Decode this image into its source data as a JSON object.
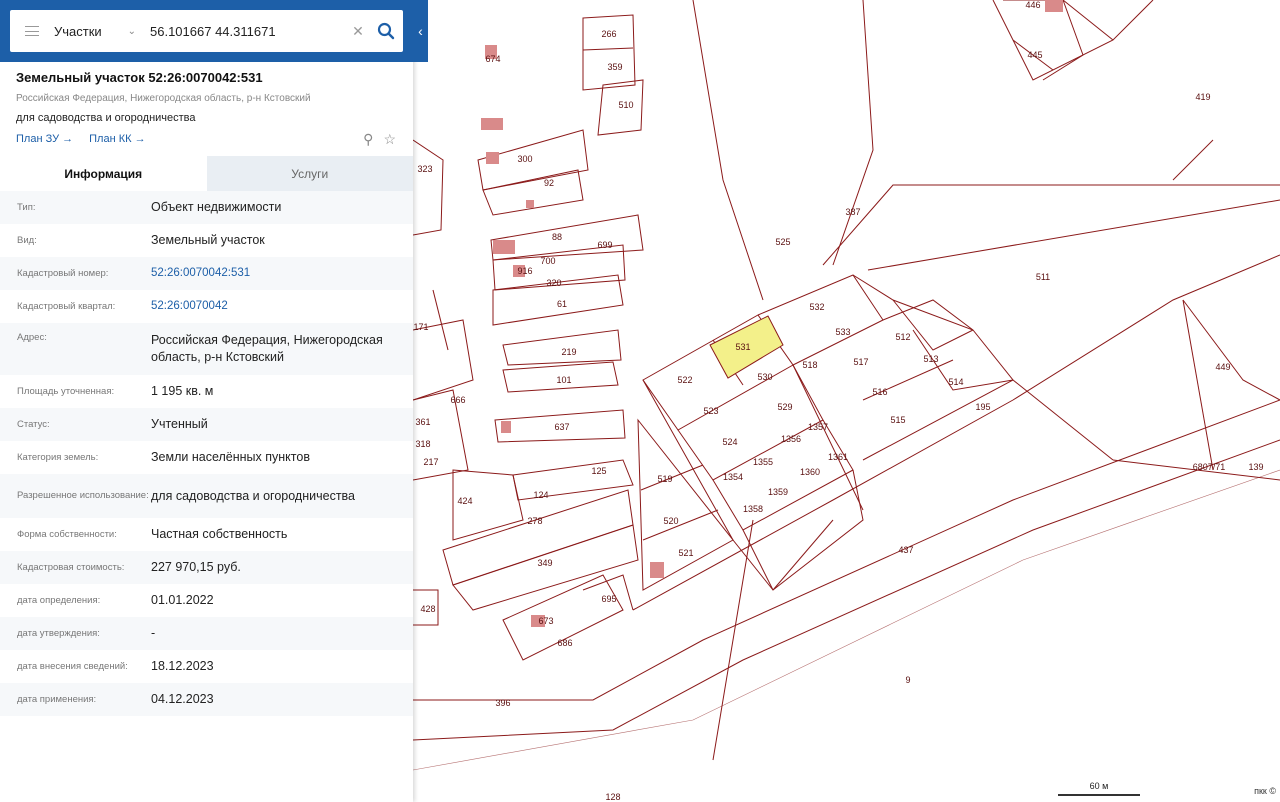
{
  "search": {
    "type_label": "Участки",
    "query": "56.101667 44.311671"
  },
  "object": {
    "title": "Земельный участок 52:26:0070042:531",
    "address_line": "Российская Федерация, Нижегородская область, р-н Кстовский",
    "purpose": "для садоводства и огородничества",
    "link_plan_zu": "План ЗУ →",
    "link_plan_kk": "План КК →"
  },
  "tabs": [
    {
      "label": "Информация",
      "active": true
    },
    {
      "label": "Услуги",
      "active": false
    }
  ],
  "info": {
    "type": {
      "key": "Тип:",
      "value": "Объект недвижимости"
    },
    "kind": {
      "key": "Вид:",
      "value": "Земельный участок"
    },
    "cad_number": {
      "key": "Кадастровый номер:",
      "value": "52:26:0070042:531"
    },
    "cad_quarter": {
      "key": "Кадастровый квартал:",
      "value": "52:26:0070042"
    },
    "address": {
      "key": "Адрес:",
      "value": "Российская Федерация, Нижегородская область, р-н Кстовский"
    },
    "area": {
      "key": "Площадь уточненная:",
      "value": "1 195 кв. м"
    },
    "status": {
      "key": "Статус:",
      "value": "Учтенный"
    },
    "land_category": {
      "key": "Категория земель:",
      "value": "Земли населённых пунктов"
    },
    "permitted_use": {
      "key": "Разрешенное использование:",
      "value": "для садоводства и огородничества"
    },
    "ownership": {
      "key": "Форма собственности:",
      "value": "Частная собственность"
    },
    "cad_value": {
      "key": "Кадастровая стоимость:",
      "value": "227 970,15 руб."
    },
    "date_determined": {
      "key": "дата определения:",
      "value": "01.01.2022"
    },
    "date_approved": {
      "key": "дата утверждения:",
      "value": "-"
    },
    "date_entered": {
      "key": "дата внесения сведений:",
      "value": "18.12.2023"
    },
    "date_applied": {
      "key": "дата применения:",
      "value": "04.12.2023"
    }
  },
  "map": {
    "scale_label": "60 м",
    "credit": "пкк ©",
    "highlight_color": "#f3f08a",
    "parcel_line_color": "#8b1a1a",
    "building_color": "#d98a8a",
    "plot_labels": [
      "531",
      "530",
      "522",
      "523",
      "524",
      "529",
      "1356",
      "1357",
      "1361",
      "1355",
      "1360",
      "1354",
      "1359",
      "1358",
      "532",
      "533",
      "512",
      "517",
      "513",
      "516",
      "514",
      "515",
      "518",
      "519",
      "520",
      "521",
      "525",
      "387",
      "419",
      "511",
      "449",
      "195",
      "6807/71",
      "139",
      "437",
      "9",
      "396",
      "266",
      "359",
      "510",
      "674",
      "300",
      "92",
      "88",
      "699",
      "700",
      "916",
      "320",
      "61",
      "219",
      "101",
      "637",
      "125",
      "124",
      "278",
      "349",
      "424",
      "673",
      "686",
      "695",
      "428",
      "323",
      "446",
      "445",
      "171",
      "666",
      "361",
      "318",
      "217",
      "128"
    ]
  }
}
